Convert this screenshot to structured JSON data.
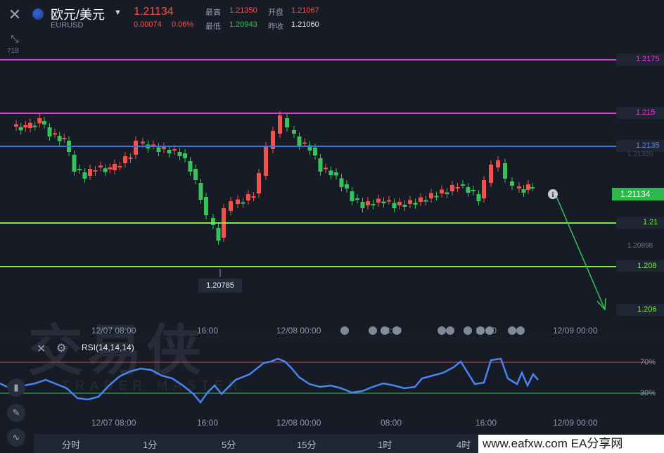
{
  "header": {
    "symbol_name": "欧元/美元",
    "symbol_code": "EURUSD",
    "last_price": "1.21134",
    "change": "0.00074",
    "change_pct": "0.06%",
    "quotes": {
      "high_label": "最高",
      "high": "1.21350",
      "open_label": "开盘",
      "open": "1.21067",
      "low_label": "最低",
      "low": "1.20943",
      "prev_close_label": "昨收",
      "prev_close": "1.21060"
    }
  },
  "chart": {
    "left_tag": "718",
    "min_label": "1.20785",
    "faint_labels": {
      "upper": "1.21320",
      "lower": "1.20898"
    },
    "price_lines": [
      {
        "label": "1.2175",
        "color": "#e83cd6"
      },
      {
        "label": "1.215",
        "color": "#e83cd6"
      },
      {
        "label": "1.2135",
        "color": "#3b74e0"
      },
      {
        "label": "1.21134",
        "color": "#2cb84a"
      },
      {
        "label": "1.21",
        "color": "#7ee84c"
      },
      {
        "label": "1.208",
        "color": "#7ee84c"
      },
      {
        "label": "1.206",
        "color": "#7ee84c"
      }
    ],
    "time_labels": [
      "12/07 08:00",
      "16:00",
      "12/08 00:00",
      "08:00",
      "16:00",
      "12/09 00:00"
    ]
  },
  "rsi": {
    "label": "RSI(14,14,14)",
    "level_high": "70%",
    "level_low": "30%",
    "time_labels": [
      "12/07 08:00",
      "16:00",
      "12/08 00:00",
      "08:00",
      "16:00",
      "12/09 00:00"
    ]
  },
  "timeframes": [
    "分时",
    "1分",
    "5分",
    "15分",
    "1时",
    "4时"
  ],
  "watermark": {
    "logo": "交易侠",
    "subtitle": "TRADER MASTER",
    "footer": "www.eafxw.com  EA分享网"
  },
  "colors": {
    "up": "#f2524a",
    "down": "#36c45a",
    "bg": "#161b26"
  }
}
